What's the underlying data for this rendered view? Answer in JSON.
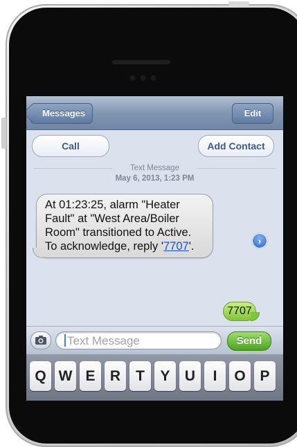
{
  "navbar": {
    "back_label": "Messages",
    "edit_label": "Edit"
  },
  "actions": {
    "call_label": "Call",
    "add_contact_label": "Add Contact"
  },
  "thread": {
    "header_label": "Text Message",
    "date_label": "May 6, 2013, 1:23 PM",
    "incoming": {
      "text_part": "At 01:23:25, alarm \"Heater Fault\" at \"West Area/Boiler Room\" transitioned to Active. To acknowledge, reply '",
      "link_text": "7707",
      "text_end": "'."
    },
    "outgoing": {
      "text": "7707"
    }
  },
  "input": {
    "placeholder": "Text Message",
    "send_label": "Send"
  },
  "keyboard": {
    "row1": [
      "Q",
      "W",
      "E",
      "R",
      "T",
      "Y",
      "U",
      "I",
      "O",
      "P"
    ]
  },
  "colors": {
    "nav_blue": "#6f86a5",
    "send_green": "#4aa41f",
    "link_blue": "#1b4fd8",
    "outgoing_green": "#7ec53a"
  },
  "icons": {
    "camera": "camera-icon",
    "disclosure": "disclosure-arrow-icon"
  }
}
